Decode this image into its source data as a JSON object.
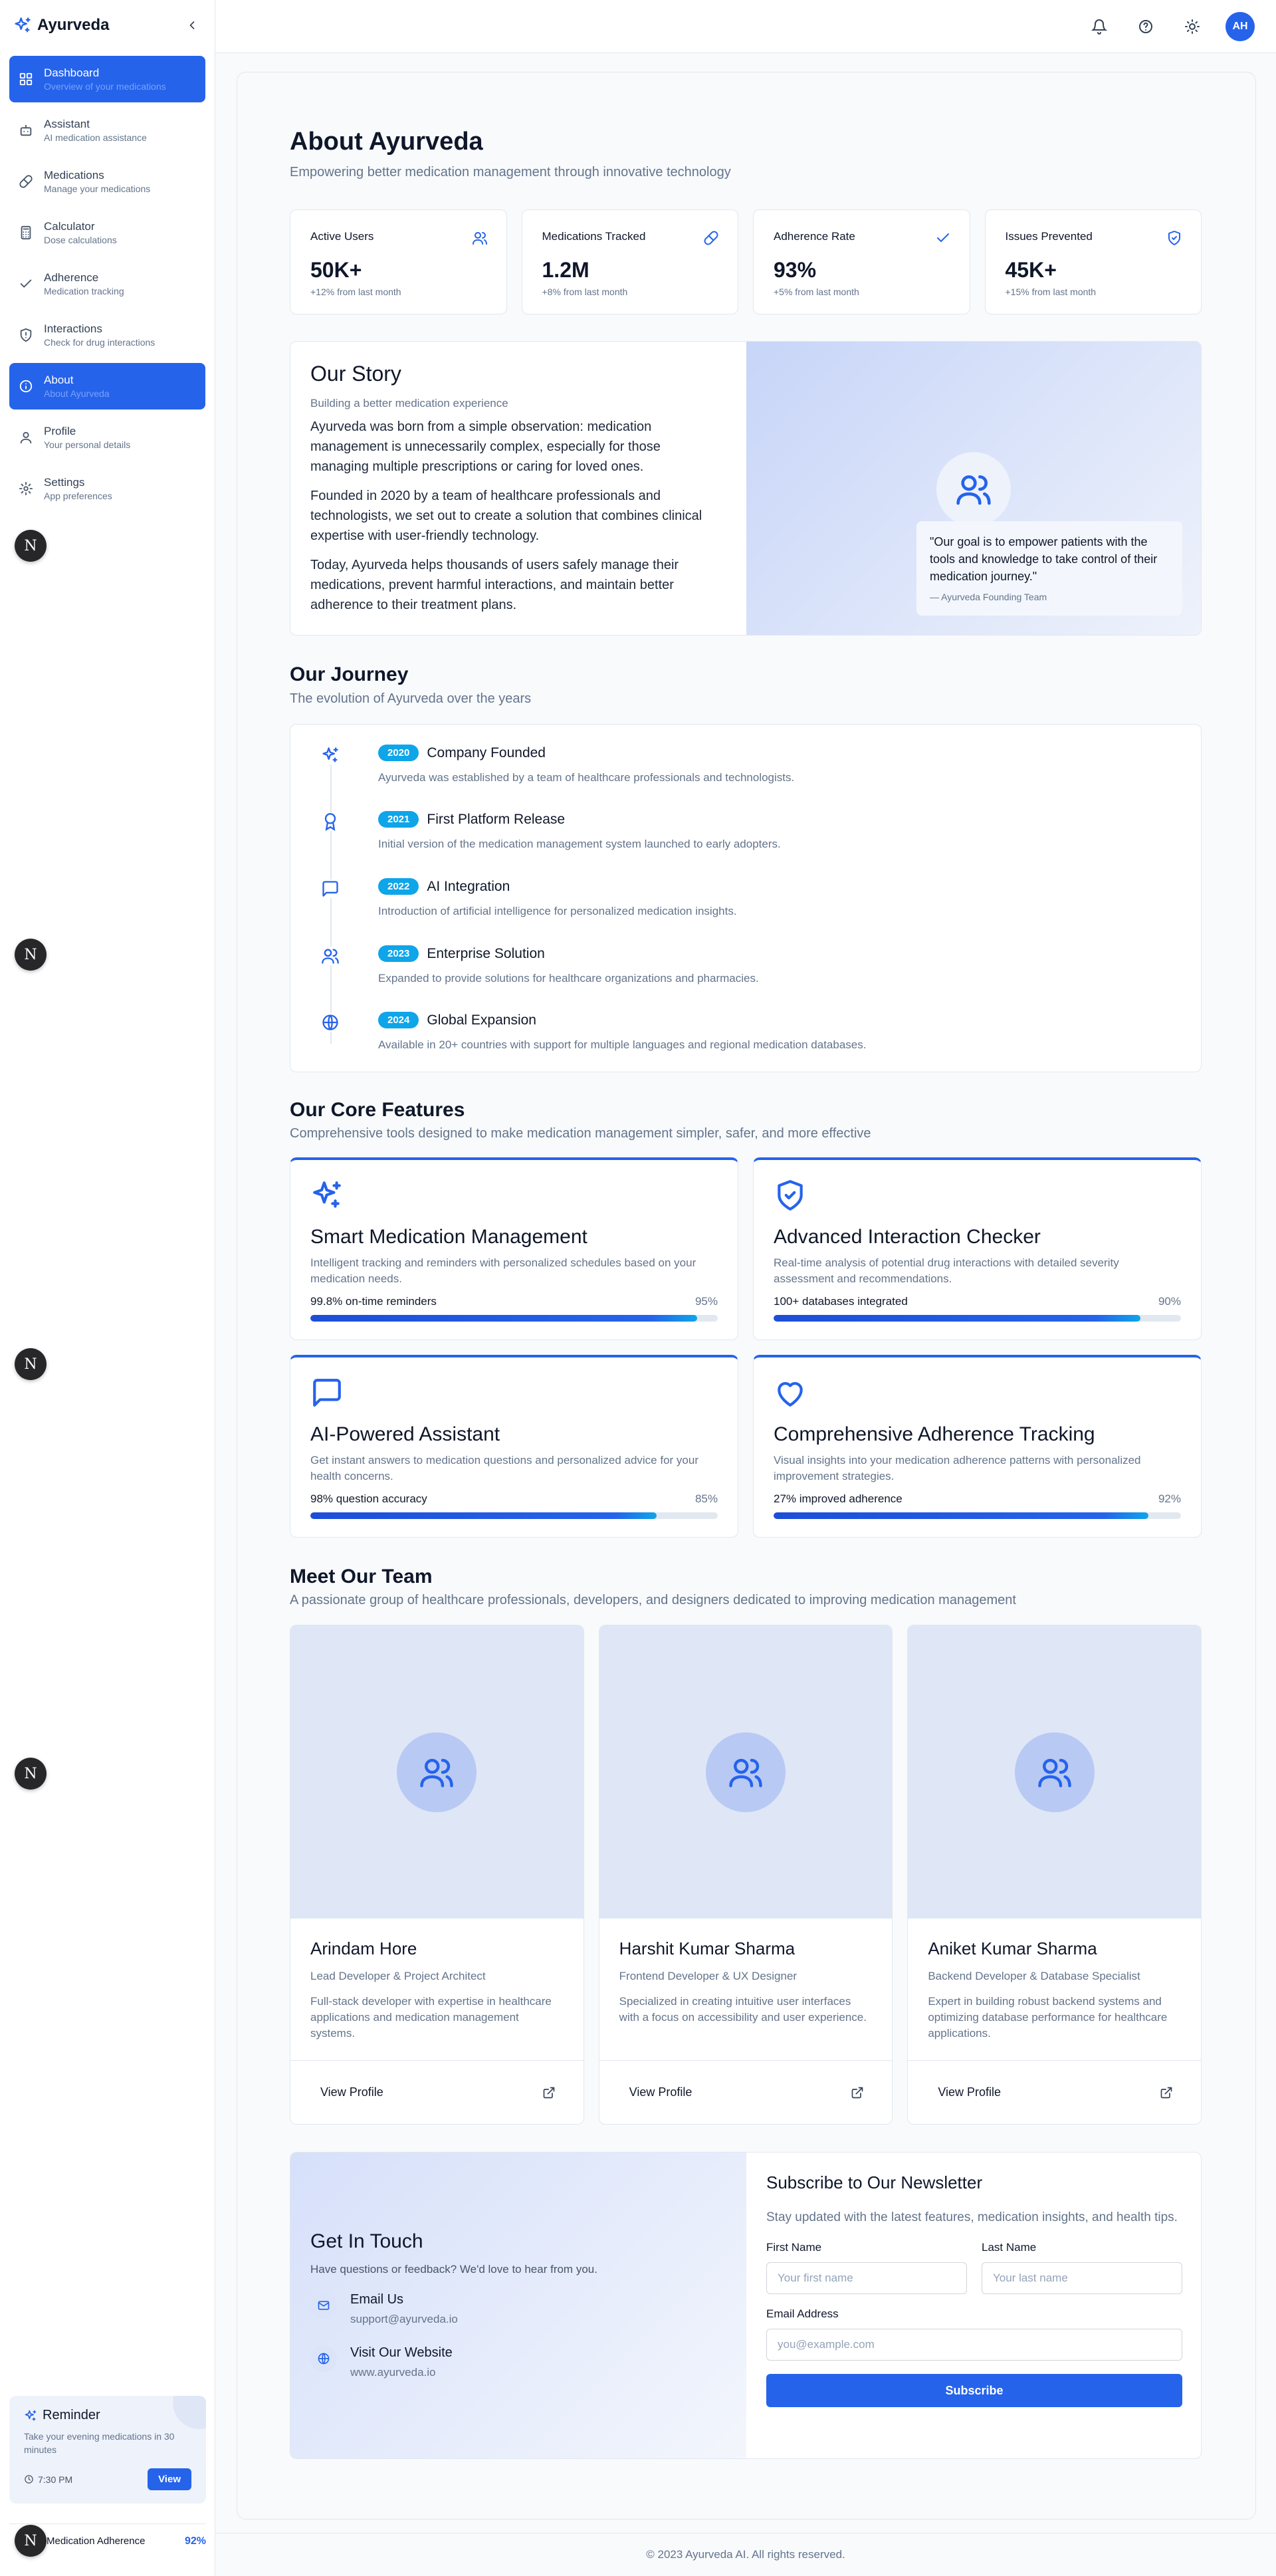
{
  "app": {
    "name": "Ayurveda"
  },
  "sidebar": {
    "items": [
      {
        "label": "Dashboard",
        "sub": "Overview of your medications",
        "icon": "grid-icon"
      },
      {
        "label": "Assistant",
        "sub": "AI medication assistance",
        "icon": "bot-icon"
      },
      {
        "label": "Medications",
        "sub": "Manage your medications",
        "icon": "pill-icon"
      },
      {
        "label": "Calculator",
        "sub": "Dose calculations",
        "icon": "calculator-icon"
      },
      {
        "label": "Adherence",
        "sub": "Medication tracking",
        "icon": "check-icon"
      },
      {
        "label": "Interactions",
        "sub": "Check for drug interactions",
        "icon": "shield-icon"
      },
      {
        "label": "About",
        "sub": "About Ayurveda",
        "icon": "info-icon"
      },
      {
        "label": "Profile",
        "sub": "Your personal details",
        "icon": "user-icon"
      },
      {
        "label": "Settings",
        "sub": "App preferences",
        "icon": "gear-icon"
      }
    ],
    "reminder": {
      "title": "Reminder",
      "text": "Take your evening medications in 30 minutes",
      "time": "7:30 PM",
      "action": "View"
    },
    "adherence": {
      "label": "Medication Adherence",
      "value": "92%"
    },
    "n_badge": "N"
  },
  "topbar": {
    "avatar": "AH"
  },
  "page": {
    "title": "About Ayurveda",
    "subtitle": "Empowering better medication management through innovative technology"
  },
  "stats": [
    {
      "label": "Active Users",
      "value": "50K+",
      "change": "+12% from last month",
      "icon": "users-icon"
    },
    {
      "label": "Medications Tracked",
      "value": "1.2M",
      "change": "+8% from last month",
      "icon": "pill-icon"
    },
    {
      "label": "Adherence Rate",
      "value": "93%",
      "change": "+5% from last month",
      "icon": "check-icon"
    },
    {
      "label": "Issues Prevented",
      "value": "45K+",
      "change": "+15% from last month",
      "icon": "shield-icon"
    }
  ],
  "story": {
    "title": "Our Story",
    "subtitle": "Building a better medication experience",
    "paragraphs": [
      "Ayurveda was born from a simple observation: medication management is unnecessarily complex, especially for those managing multiple prescriptions or caring for loved ones.",
      "Founded in 2020 by a team of healthcare professionals and technologists, we set out to create a solution that combines clinical expertise with user-friendly technology.",
      "Today, Ayurveda helps thousands of users safely manage their medications, prevent harmful interactions, and maintain better adherence to their treatment plans."
    ],
    "quote": "\"Our goal is to empower patients with the tools and knowledge to take control of their medication journey.\"",
    "quote_by": "— Ayurveda Founding Team"
  },
  "journey": {
    "title": "Our Journey",
    "subtitle": "The evolution of Ayurveda over the years",
    "items": [
      {
        "year": "2020",
        "title": "Company Founded",
        "desc": "Ayurveda was established by a team of healthcare professionals and technologists.",
        "icon": "sparkles-icon"
      },
      {
        "year": "2021",
        "title": "First Platform Release",
        "desc": "Initial version of the medication management system launched to early adopters.",
        "icon": "award-icon"
      },
      {
        "year": "2022",
        "title": "AI Integration",
        "desc": "Introduction of artificial intelligence for personalized medication insights.",
        "icon": "message-icon"
      },
      {
        "year": "2023",
        "title": "Enterprise Solution",
        "desc": "Expanded to provide solutions for healthcare organizations and pharmacies.",
        "icon": "users-icon"
      },
      {
        "year": "2024",
        "title": "Global Expansion",
        "desc": "Available in 20+ countries with support for multiple languages and regional medication databases.",
        "icon": "globe-icon"
      }
    ]
  },
  "features": {
    "title": "Our Core Features",
    "subtitle": "Comprehensive tools designed to make medication management simpler, safer, and more effective",
    "items": [
      {
        "title": "Smart Medication Management",
        "desc": "Intelligent tracking and reminders with personalized schedules based on your medication needs.",
        "metric": "99.8% on-time reminders",
        "pct": "95%",
        "progress": 0.95,
        "icon": "sparkles-icon"
      },
      {
        "title": "Advanced Interaction Checker",
        "desc": "Real-time analysis of potential drug interactions with detailed severity assessment and recommendations.",
        "metric": "100+ databases integrated",
        "pct": "90%",
        "progress": 0.9,
        "icon": "shield-check-icon"
      },
      {
        "title": "AI-Powered Assistant",
        "desc": "Get instant answers to medication questions and personalized advice for your health concerns.",
        "metric": "98% question accuracy",
        "pct": "85%",
        "progress": 0.85,
        "icon": "message-icon"
      },
      {
        "title": "Comprehensive Adherence Tracking",
        "desc": "Visual insights into your medication adherence patterns with personalized improvement strategies.",
        "metric": "27% improved adherence",
        "pct": "92%",
        "progress": 0.92,
        "icon": "heart-icon"
      }
    ]
  },
  "team": {
    "title": "Meet Our Team",
    "subtitle": "A passionate group of healthcare professionals, developers, and designers dedicated to improving medication management",
    "members": [
      {
        "name": "Arindam Hore",
        "role": "Lead Developer & Project Architect",
        "bio": "Full-stack developer with expertise in healthcare applications and medication management systems.",
        "link": "View Profile"
      },
      {
        "name": "Harshit Kumar Sharma",
        "role": "Frontend Developer & UX Designer",
        "bio": "Specialized in creating intuitive user interfaces with a focus on accessibility and user experience.",
        "link": "View Profile"
      },
      {
        "name": "Aniket Kumar Sharma",
        "role": "Backend Developer & Database Specialist",
        "bio": "Expert in building robust backend systems and optimizing database performance for healthcare applications.",
        "link": "View Profile"
      }
    ]
  },
  "contact": {
    "title": "Get In Touch",
    "subtitle": "Have questions or feedback? We'd love to hear from you.",
    "email_label": "Email Us",
    "email": "support@ayurveda.io",
    "web_label": "Visit Our Website",
    "web": "www.ayurveda.io"
  },
  "newsletter": {
    "title": "Subscribe to Our Newsletter",
    "subtitle": "Stay updated with the latest features, medication insights, and health tips.",
    "first_label": "First Name",
    "first_placeholder": "Your first name",
    "last_label": "Last Name",
    "last_placeholder": "Your last name",
    "email_label": "Email Address",
    "email_placeholder": "you@example.com",
    "button": "Subscribe"
  },
  "footer": {
    "text": "© 2023 Ayurveda AI. All rights reserved."
  }
}
